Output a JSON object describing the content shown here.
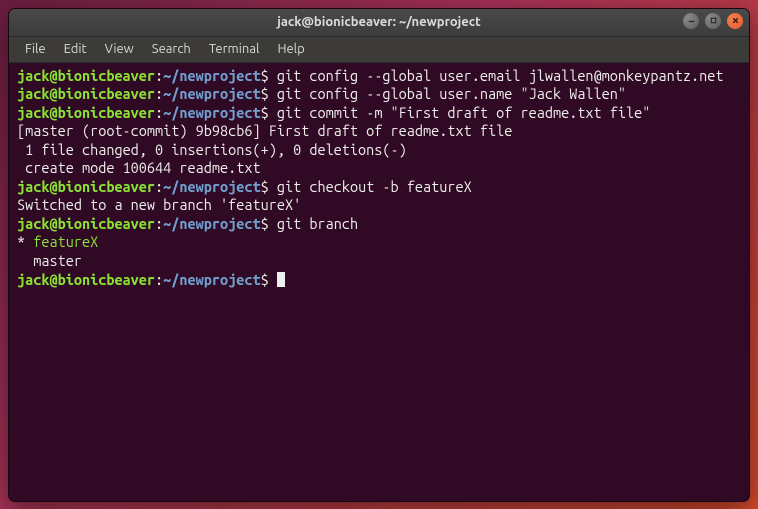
{
  "window": {
    "title": "jack@bionicbeaver: ~/newproject"
  },
  "menubar": {
    "items": [
      "File",
      "Edit",
      "View",
      "Search",
      "Terminal",
      "Help"
    ]
  },
  "prompt": {
    "user_host": "jack@bionicbeaver",
    "colon": ":",
    "path": "~/newproject",
    "symbol": "$"
  },
  "lines": {
    "cmd1": "git config --global user.email jlwallen@monkeypantz.net",
    "cmd2": "git config --global user.name \"Jack Wallen\"",
    "cmd3": "git commit -m \"First draft of readme.txt file\"",
    "out3a": "[master (root-commit) 9b98cb6] First draft of readme.txt file",
    "out3b": " 1 file changed, 0 insertions(+), 0 deletions(-)",
    "out3c": " create mode 100644 readme.txt",
    "cmd4": "git checkout -b featureX",
    "out4a": "Switched to a new branch 'featureX'",
    "cmd5": "git branch",
    "out5a_star": "* ",
    "out5a_branch": "featureX",
    "out5b": "  master"
  }
}
